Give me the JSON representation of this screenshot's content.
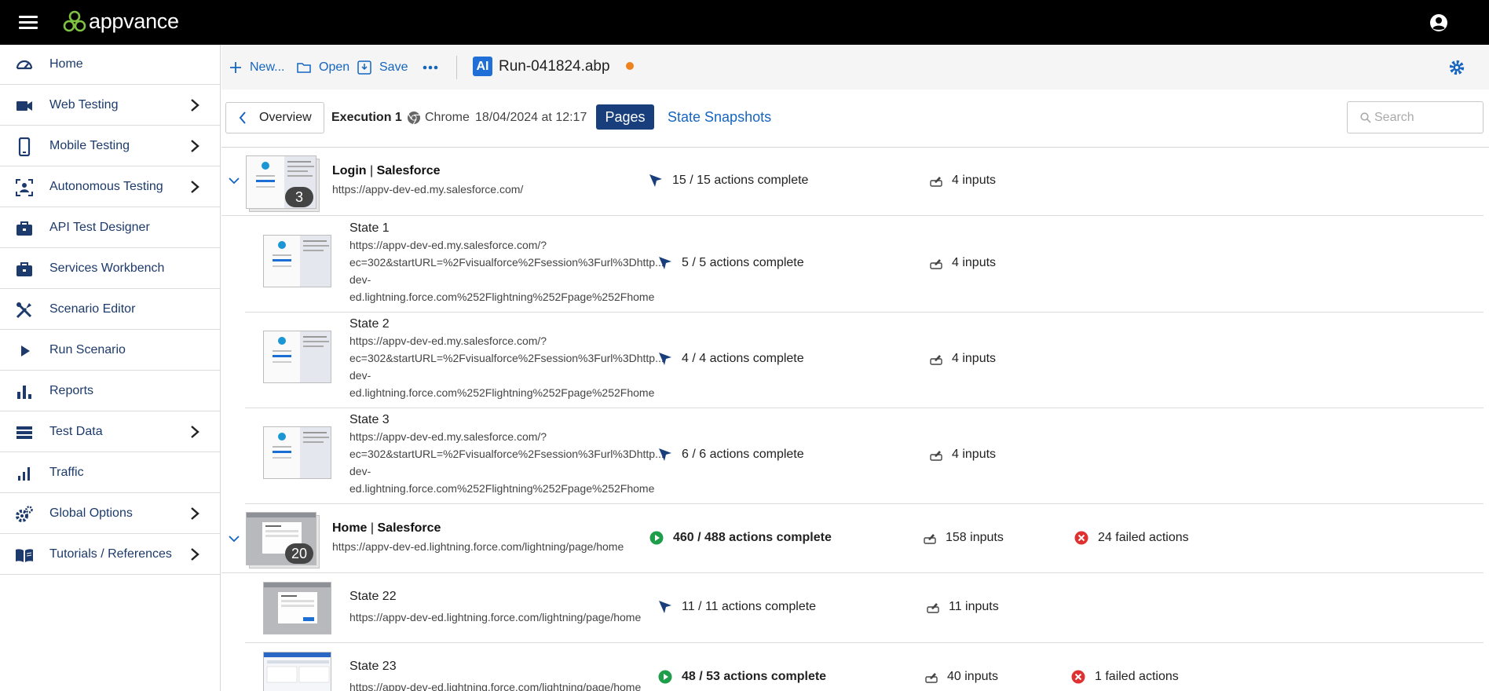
{
  "app": {
    "logo_text": "appvance"
  },
  "sidebar": {
    "items": [
      {
        "label": "Home",
        "icon": "dashboard-icon"
      },
      {
        "label": "Web Testing",
        "icon": "video-camera-icon"
      },
      {
        "label": "Mobile Testing",
        "icon": "smartphone-icon"
      },
      {
        "label": "Autonomous Testing",
        "icon": "ai-scan-icon"
      },
      {
        "label": "API Test Designer",
        "icon": "briefcase-icon"
      },
      {
        "label": "Services Workbench",
        "icon": "briefcase-icon"
      },
      {
        "label": "Scenario Editor",
        "icon": "tools-icon"
      },
      {
        "label": "Run Scenario",
        "icon": "play-icon"
      },
      {
        "label": "Reports",
        "icon": "bar-chart-icon"
      },
      {
        "label": "Test Data",
        "icon": "list-icon"
      },
      {
        "label": "Traffic",
        "icon": "signal-bars-icon"
      },
      {
        "label": "Global Options",
        "icon": "gears-icon"
      },
      {
        "label": "Tutorials / References",
        "icon": "book-icon"
      }
    ]
  },
  "toolbar": {
    "new_label": "New...",
    "open_label": "Open",
    "save_label": "Save",
    "ai_badge": "AI",
    "file_name": "Run-041824.abp"
  },
  "execution": {
    "overview_label": "Overview",
    "label": "Execution 1",
    "browser": "Chrome",
    "date": "18/04/2024 at 12:17",
    "pages_tab": "Pages",
    "snapshots_tab": "State Snapshots",
    "search_placeholder": "Search"
  },
  "pages": [
    {
      "title": "Login",
      "site": "Salesforce",
      "url": "https://appv-dev-ed.my.salesforce.com/",
      "count": "3",
      "actions": "15 / 15 actions complete",
      "inputs": "4 inputs",
      "failed": "",
      "states": [
        {
          "title": "State 1",
          "url_lines": [
            "https://appv-dev-ed.my.salesforce.com/?",
            "ec=302&startURL=%2Fvisualforce%2Fsession%3Furl%3Dhttp...",
            "dev-",
            "ed.lightning.force.com%252Flightning%252Fpage%252Fhome"
          ],
          "actions": "5 / 5 actions complete",
          "inputs": "4 inputs"
        },
        {
          "title": "State 2",
          "url_lines": [
            "https://appv-dev-ed.my.salesforce.com/?",
            "ec=302&startURL=%2Fvisualforce%2Fsession%3Furl%3Dhttp...",
            "dev-",
            "ed.lightning.force.com%252Flightning%252Fpage%252Fhome"
          ],
          "actions": "4 / 4 actions complete",
          "inputs": "4 inputs"
        },
        {
          "title": "State 3",
          "url_lines": [
            "https://appv-dev-ed.my.salesforce.com/?",
            "ec=302&startURL=%2Fvisualforce%2Fsession%3Furl%3Dhttp...",
            "dev-",
            "ed.lightning.force.com%252Flightning%252Fpage%252Fhome"
          ],
          "actions": "6 / 6 actions complete",
          "inputs": "4 inputs"
        }
      ]
    },
    {
      "title": "Home",
      "site": "Salesforce",
      "url": "https://appv-dev-ed.lightning.force.com/lightning/page/home",
      "count": "20",
      "actions": "460 / 488 actions complete",
      "inputs": "158 inputs",
      "failed": "24 failed actions",
      "states": [
        {
          "title": "State 22",
          "url_lines": [
            "https://appv-dev-ed.lightning.force.com/lightning/page/home"
          ],
          "actions": "11 / 11 actions complete",
          "inputs": "11 inputs",
          "failed": ""
        },
        {
          "title": "State 23",
          "url_lines": [
            "https://appv-dev-ed.lightning.force.com/lightning/page/home"
          ],
          "actions": "48 / 53 actions complete",
          "inputs": "40 inputs",
          "failed": "1 failed actions"
        }
      ]
    }
  ],
  "colors": {
    "topbar": "#000000",
    "accent": "#1565c0",
    "nav_text": "#1c3a6b",
    "pages_tab": "#183f7c",
    "unsaved": "#f0821e",
    "success": "#1e9e4a",
    "failure": "#e03030",
    "cursor_icon": "#183f7c"
  }
}
